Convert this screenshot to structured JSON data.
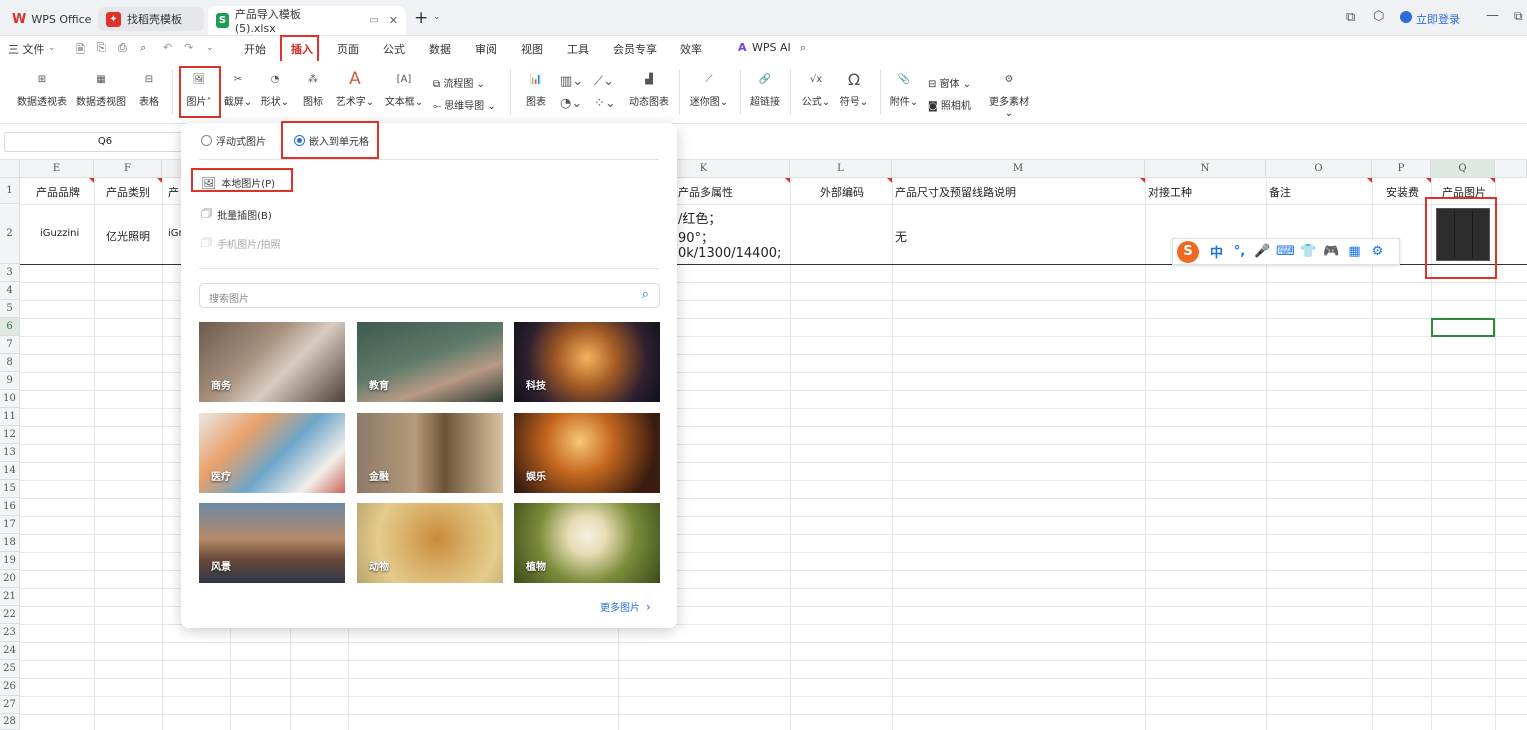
{
  "tabs": [
    {
      "label": "WPS Office",
      "icon": "wps-logo-icon"
    },
    {
      "label": "找稻壳模板",
      "icon": "docer-icon"
    },
    {
      "label": "产品导入模板 (5).xlsx",
      "icon": "spreadsheet-s-icon"
    }
  ],
  "topright": {
    "login": "立即登录"
  },
  "menu": {
    "file": "三 文件",
    "items": [
      "开始",
      "插入",
      "页面",
      "公式",
      "数据",
      "审阅",
      "视图",
      "工具",
      "会员专享",
      "效率"
    ],
    "wpsai": "WPS AI"
  },
  "ribbon": {
    "pivot_table": "数据透视表",
    "pivot_chart": "数据透视图",
    "table": "表格",
    "picture": "图片",
    "screenshot": "截屏",
    "shape": "形状",
    "icon": "图标",
    "wordart": "艺术字",
    "textbox": "文本框",
    "flowchart": "流程图",
    "mindmap": "思维导图",
    "chart": "图表",
    "dynamic_chart": "动态图表",
    "sparkline": "迷你图",
    "hyperlink": "超链接",
    "formula": "公式",
    "symbol": "符号",
    "attachment": "附件",
    "form": "窗体",
    "camera": "照相机",
    "more_material": "更多素材"
  },
  "namebox": "Q6",
  "columns": [
    {
      "letter": "E"
    },
    {
      "letter": "F"
    },
    {
      "letter": "G"
    },
    {
      "letter": "H"
    },
    {
      "letter": "I"
    },
    {
      "letter": "J"
    },
    {
      "letter": "K"
    },
    {
      "letter": "L"
    },
    {
      "letter": "M"
    },
    {
      "letter": "N"
    },
    {
      "letter": "O"
    },
    {
      "letter": "P"
    },
    {
      "letter": "Q"
    }
  ],
  "rows": [
    "1",
    "2",
    "3",
    "4",
    "5",
    "6",
    "7",
    "8",
    "9",
    "10",
    "11",
    "12",
    "13",
    "14",
    "15",
    "16",
    "17",
    "18",
    "19",
    "20",
    "21",
    "22",
    "23",
    "24",
    "25",
    "26",
    "27",
    "28"
  ],
  "row1": {
    "E": "产品品牌",
    "F": "产品类别",
    "G": "产",
    "K": "产品多属性",
    "L": "外部编码",
    "M": "产品尺寸及预留线路说明",
    "N": "对接工种",
    "O": "备注",
    "P": "安装费",
    "Q": "产品图片"
  },
  "row2": {
    "E": "iGuzzini",
    "F": "亿光照明",
    "G": "iGr",
    "K1": "/红色；",
    "K2": "90°；",
    "K3": "0k/1300/14400;",
    "M": "无"
  },
  "popup": {
    "floating": "浮动式图片",
    "embed": "嵌入到单元格",
    "local": "本地图片(P)",
    "batch": "批量插图(B)",
    "phone": "手机图片/拍照",
    "search_placeholder": "搜索图片",
    "categories": [
      "商务",
      "教育",
      "科技",
      "医疗",
      "金融",
      "娱乐",
      "风景",
      "动物",
      "植物"
    ],
    "more": "更多图片"
  },
  "ime": {
    "logo": "S",
    "mode": "中"
  }
}
